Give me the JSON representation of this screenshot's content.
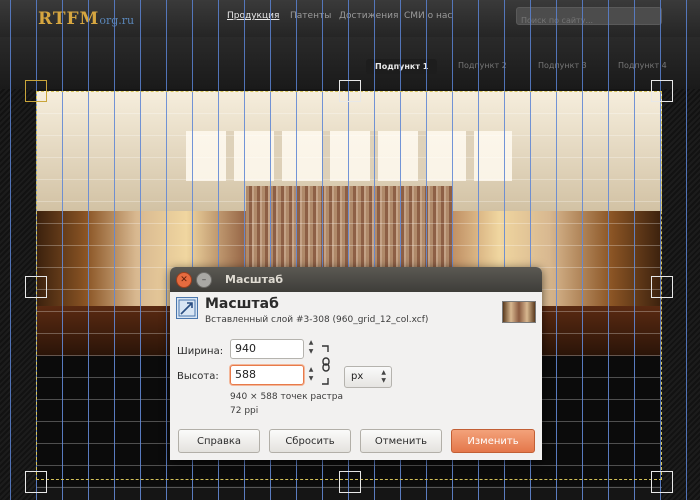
{
  "website": {
    "logo": {
      "main": "RTFM",
      "suffix": "org.ru"
    },
    "nav": [
      {
        "label": "Продукция",
        "active": true
      },
      {
        "label": "Патенты",
        "active": false
      },
      {
        "label": "Достижения",
        "active": false
      },
      {
        "label": "СМИ о нас",
        "active": false
      }
    ],
    "search_placeholder": "Поиск по сайту...",
    "subnav": [
      {
        "label": "Подпункт 1",
        "active": true
      },
      {
        "label": "Подпункт 2",
        "active": false
      },
      {
        "label": "Подпункт 3",
        "active": false
      },
      {
        "label": "Подпункт 4",
        "active": false
      }
    ]
  },
  "dialog": {
    "window_title": "Масштаб",
    "header_title": "Масштаб",
    "header_subtitle": "Вставленный слой #3-308 (960_grid_12_col.xcf)",
    "width_label": "Ширина:",
    "width_value": "940",
    "height_label": "Высота:",
    "height_value": "588",
    "unit": "px",
    "info_size": "940 × 588 точек растра",
    "info_resolution": "72 ppi",
    "buttons": {
      "help": "Справка",
      "reset": "Сбросить",
      "cancel": "Отменить",
      "change": "Изменить"
    }
  },
  "colors": {
    "accent": "#e4774b",
    "guides": "#5a82d2",
    "logo": "#d6a640"
  }
}
